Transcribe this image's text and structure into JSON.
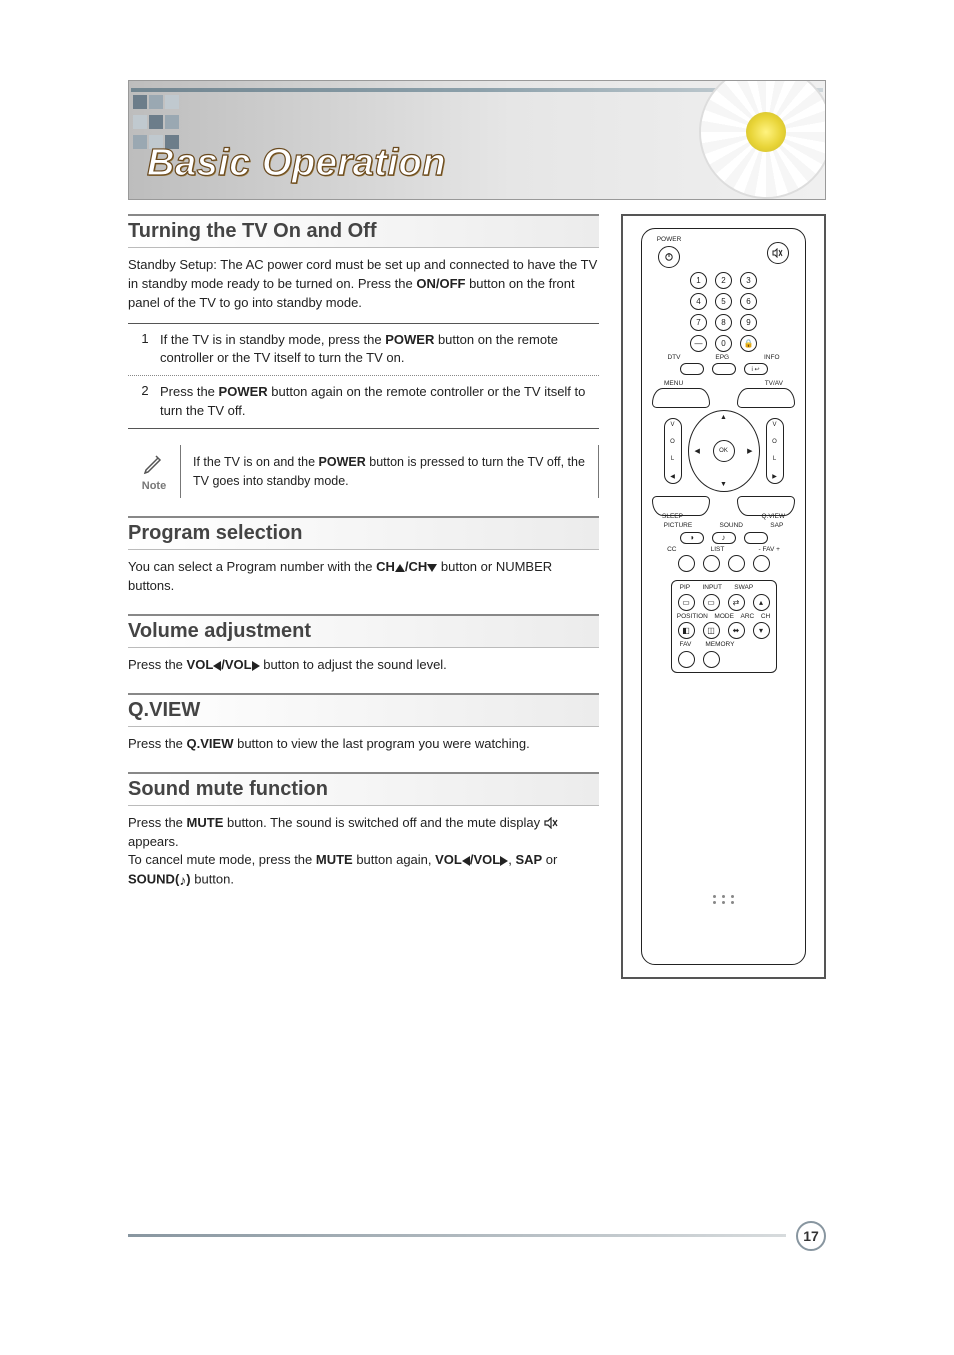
{
  "banner_title": "Basic Operation",
  "sections": {
    "s1": {
      "title": "Turning the TV On and Off",
      "intro_pre": "Standby Setup: The AC power cord must be set up and connected to have the TV in standby mode ready to be turned on. Press the ",
      "intro_b": "ON/OFF",
      "intro_post": " button on the front panel of the TV to go into standby mode.",
      "step1_num": "1",
      "step1_pre": "If the TV is in standby mode, press the ",
      "step1_b": "POWER",
      "step1_post": " button on the remote controller or the TV itself to turn the TV on.",
      "step2_num": "2",
      "step2_pre": "Press the ",
      "step2_b": "POWER",
      "step2_post": " button again on the remote controller or the TV itself to turn the TV off.",
      "note_label": "Note",
      "note_pre": "If the TV is on and the ",
      "note_b": "POWER",
      "note_post": " button is pressed to turn the TV off, the TV goes into standby mode."
    },
    "s2": {
      "title": "Program selection",
      "pre": "You can select a Program number with the ",
      "b1": "CH",
      "mid": "/CH",
      "post": " button or NUMBER buttons."
    },
    "s3": {
      "title": "Volume adjustment",
      "pre": "Press the ",
      "b1": "VOL",
      "mid": "/VOL",
      "post": " button to adjust the sound level."
    },
    "s4": {
      "title": "Q.VIEW",
      "pre": "Press the ",
      "b": "Q.VIEW",
      "post": " button to view the last program you were watching."
    },
    "s5": {
      "title": "Sound mute function",
      "l1_pre": "Press the  ",
      "l1_b": "MUTE",
      "l1_post": " button. The sound is switched off and the mute display ",
      "l1_tail": " appears.",
      "l2_pre": "To cancel mute mode, press the ",
      "l2_b1": "MUTE",
      "l2_mid1": " button again, ",
      "l2_b2": "VOL",
      "l2_mid2": "/VOL",
      "l2_mid3": ", ",
      "l2_b3": "SAP",
      "l2_mid4": " or  ",
      "l2_b4": "SOUND(",
      "l2_b5": ")",
      "l2_post": " button."
    }
  },
  "remote": {
    "power": "POWER",
    "menu": "MENU",
    "tvav": "TV/AV",
    "ok": "OK",
    "sleep": "SLEEP",
    "qview": "Q.VIEW",
    "picture": "PICTURE",
    "sound": "SOUND",
    "sap": "SAP",
    "cc": "CC",
    "list": "LIST",
    "favm": "- FAV +",
    "dtv": "DTV",
    "epg": "EPG",
    "info": "INFO",
    "ireturn": "i ↩",
    "pip": "PIP",
    "input": "INPUT",
    "swap": "SWAP",
    "position": "POSITION",
    "mode": "MODE",
    "arc": "ARC",
    "ch": "CH",
    "fav": "FAV",
    "memory": "MEMORY",
    "vol": "VOL",
    "nums": [
      "1",
      "2",
      "3",
      "4",
      "5",
      "6",
      "7",
      "8",
      "9",
      "0"
    ],
    "dash": "—"
  },
  "page_number": "17"
}
